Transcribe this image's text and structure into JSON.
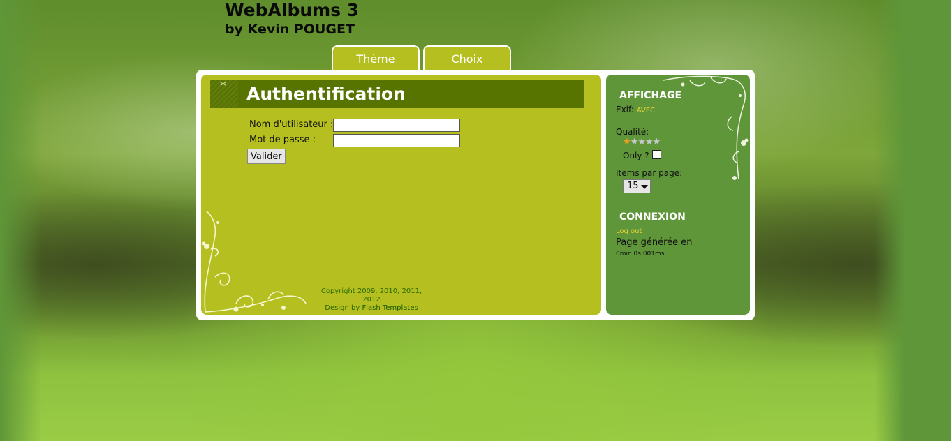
{
  "site": {
    "title": "WebAlbums 3",
    "subtitle": "by Kevin POUGET"
  },
  "tabs": [
    {
      "label": "Thème"
    },
    {
      "label": "Choix"
    }
  ],
  "main": {
    "heading": "Authentification",
    "form": {
      "username_label": "Nom d'utilisateur :",
      "password_label": "Mot de passe :",
      "username_value": "",
      "password_value": "",
      "submit_label": "Valider"
    },
    "footer": {
      "copyright": "Copyright 2009, 2010, 2011, 2012",
      "design_prefix": "Design by",
      "design_link": "Flash Templates"
    }
  },
  "sidebar": {
    "affichage": {
      "title": "AFFICHAGE",
      "exif_label": "Exif:",
      "exif_value": "AVEC",
      "quality_label": "Qualité:",
      "quality_stars": 1,
      "quality_max": 5,
      "only_label": "Only ?",
      "only_checked": false,
      "items_label": "Items par page:",
      "items_value": "15"
    },
    "connexion": {
      "title": "CONNEXION",
      "logout": "Log out",
      "generated_label": "Page générée en",
      "generated_time": "0min 0s 001ms."
    }
  },
  "colors": {
    "main_panel": "#b5bf1f",
    "side_panel": "#5e9639",
    "heading_bar": "#577300",
    "accent_link": "#e8d23a",
    "star_on": "#f0a020",
    "star_off": "#c8cad0"
  }
}
